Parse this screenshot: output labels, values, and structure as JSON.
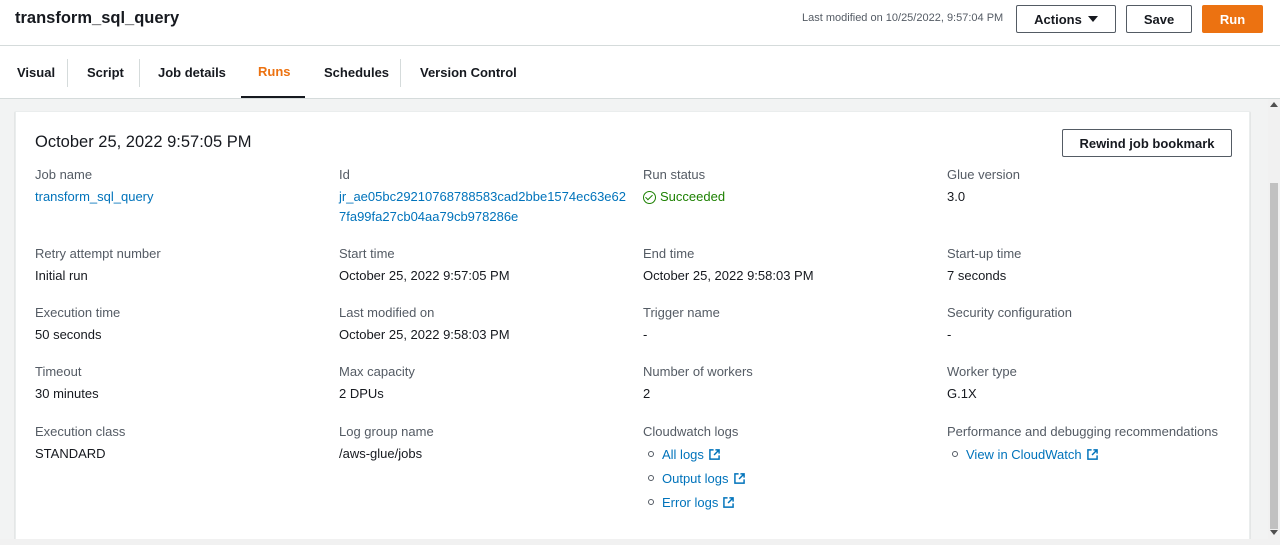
{
  "header": {
    "job_name": "transform_sql_query",
    "last_modified": "Last modified on 10/25/2022, 9:57:04 PM",
    "actions_label": "Actions",
    "save_label": "Save",
    "run_label": "Run"
  },
  "tabs": [
    {
      "label": "Visual"
    },
    {
      "label": "Script"
    },
    {
      "label": "Job details"
    },
    {
      "label": "Runs",
      "active": true
    },
    {
      "label": "Schedules"
    },
    {
      "label": "Version Control"
    }
  ],
  "run": {
    "title": "October 25, 2022 9:57:05 PM",
    "rewind_label": "Rewind job bookmark",
    "fields": {
      "job_name": {
        "label": "Job name",
        "value": "transform_sql_query"
      },
      "id": {
        "label": "Id",
        "value_line1": "jr_ae05bc29210768788583cad2bbe1574ec63e62",
        "value_line2": "7fa99fa27cb04aa79cb978286e"
      },
      "run_status": {
        "label": "Run status",
        "value": "Succeeded"
      },
      "glue_version": {
        "label": "Glue version",
        "value": "3.0"
      },
      "retry_attempt": {
        "label": "Retry attempt number",
        "value": "Initial run"
      },
      "start_time": {
        "label": "Start time",
        "value": "October 25, 2022 9:57:05 PM"
      },
      "end_time": {
        "label": "End time",
        "value": "October 25, 2022 9:58:03 PM"
      },
      "startup_time": {
        "label": "Start-up time",
        "value": "7 seconds"
      },
      "execution_time": {
        "label": "Execution time",
        "value": "50 seconds"
      },
      "last_modified_on": {
        "label": "Last modified on",
        "value": "October 25, 2022 9:58:03 PM"
      },
      "trigger_name": {
        "label": "Trigger name",
        "value": "-"
      },
      "security_config": {
        "label": "Security configuration",
        "value": "-"
      },
      "timeout": {
        "label": "Timeout",
        "value": "30 minutes"
      },
      "max_capacity": {
        "label": "Max capacity",
        "value": "2 DPUs"
      },
      "num_workers": {
        "label": "Number of workers",
        "value": "2"
      },
      "worker_type": {
        "label": "Worker type",
        "value": "G.1X"
      },
      "execution_class": {
        "label": "Execution class",
        "value": "STANDARD"
      },
      "log_group": {
        "label": "Log group name",
        "value": "/aws-glue/jobs"
      },
      "cloudwatch_logs": {
        "label": "Cloudwatch logs",
        "links": [
          "All logs",
          "Output logs",
          "Error logs"
        ]
      },
      "perf_recs": {
        "label": "Performance and debugging recommendations",
        "links": [
          "View in CloudWatch"
        ]
      }
    }
  },
  "colors": {
    "accent": "#ec7211",
    "link": "#0073bb",
    "success": "#1d8102"
  }
}
